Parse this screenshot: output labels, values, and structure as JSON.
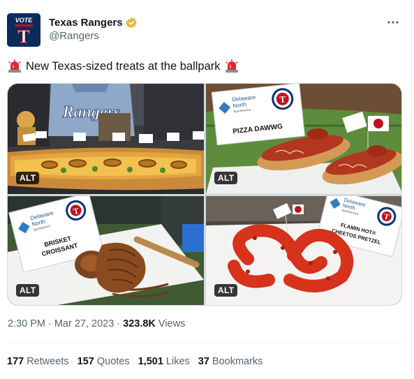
{
  "author": {
    "display_name": "Texas Rangers",
    "handle": "@Rangers",
    "avatar_label": "VOTE",
    "avatar_letter": "T",
    "verified_color": "#e8b53a"
  },
  "tweet": {
    "emoji_left": "rotating-light-icon",
    "text": "New Texas-sized treats at the ballpark",
    "emoji_right": "rotating-light-icon"
  },
  "media": [
    {
      "alt_badge": "ALT",
      "jersey_text": "Rangers"
    },
    {
      "alt_badge": "ALT",
      "sign_brand_1": "Delaware",
      "sign_brand_2": "North",
      "sign_brand_3": "Sportservice",
      "sign_title": "PIZZA DAWWG"
    },
    {
      "alt_badge": "ALT",
      "sign_brand_1": "Delaware",
      "sign_brand_2": "North",
      "sign_brand_3": "Sportservice",
      "sign_title_1": "BRISKET",
      "sign_title_2": "CROISSANT"
    },
    {
      "alt_badge": "ALT",
      "sign_brand_1": "Delaware",
      "sign_brand_2": "North",
      "sign_brand_3": "Sportservice",
      "sign_title_1": "FLAMIN HOT®",
      "sign_title_2": "CHEETOS PRETZEL"
    }
  ],
  "meta": {
    "time": "2:30 PM",
    "date": "Mar 27, 2023",
    "separator": "·",
    "views_count": "323.8K",
    "views_label": "Views"
  },
  "stats": [
    {
      "count": "177",
      "label": "Retweets"
    },
    {
      "count": "157",
      "label": "Quotes"
    },
    {
      "count": "1,501",
      "label": "Likes"
    },
    {
      "count": "37",
      "label": "Bookmarks"
    }
  ],
  "colors": {
    "text_primary": "#0f1419",
    "text_secondary": "#536471",
    "divider": "#eff3f4",
    "rangers_blue": "#003278",
    "rangers_red": "#c0111f"
  }
}
